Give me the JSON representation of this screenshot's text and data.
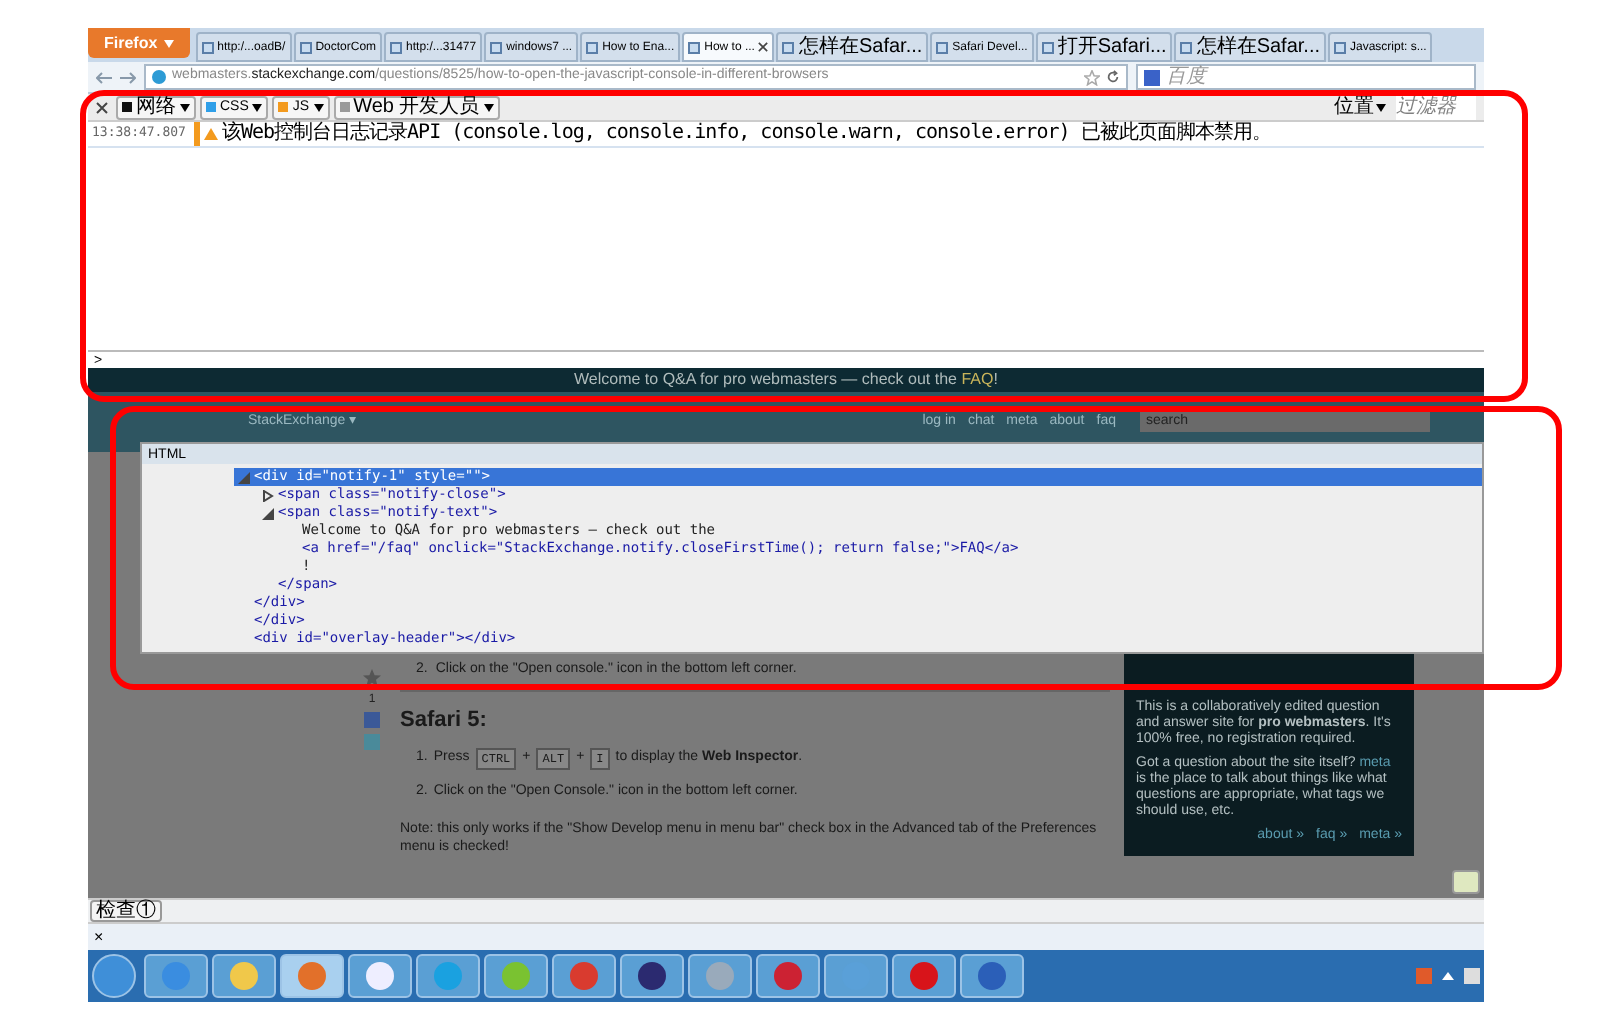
{
  "browser": {
    "menu_button": "Firefox",
    "tabs": [
      {
        "label": "http:/...oadB/",
        "selected": false
      },
      {
        "label": "DoctorCom",
        "selected": false
      },
      {
        "label": "http:/...31477",
        "selected": false
      },
      {
        "label": "windows7 ...",
        "selected": false
      },
      {
        "label": "How to Ena...",
        "selected": false
      },
      {
        "label": "How to ...",
        "selected": true
      },
      {
        "label": "怎样在Safar...",
        "selected": false
      },
      {
        "label": "Safari Devel...",
        "selected": false
      },
      {
        "label": "打开Safari...",
        "selected": false
      },
      {
        "label": "怎样在Safar...",
        "selected": false
      },
      {
        "label": "Javascript: s...",
        "selected": false
      }
    ],
    "url": {
      "subdomain": "webmasters.",
      "domain": "stackexchange.com",
      "path": "/questions/8525/how-to-open-the-javascript-console-in-different-browsers"
    },
    "search_placeholder": "百度"
  },
  "console": {
    "filters": [
      {
        "label": "网络",
        "color": "#111111"
      },
      {
        "label": "CSS",
        "color": "#2f9fe8"
      },
      {
        "label": "JS",
        "color": "#f39a1e"
      },
      {
        "label": "Web 开发人员",
        "color": "#9a9a9a"
      }
    ],
    "position_label": "位置",
    "filter_placeholder": "过滤器",
    "logs": [
      {
        "kind": "warning",
        "time": "13:38:47.807",
        "message": "该Web控制台日志记录API (console.log, console.info, console.warn, console.error) 已被此页面脚本禁用。"
      }
    ],
    "prompt": ">"
  },
  "page": {
    "banner": {
      "text": "Welcome to Q&A for pro webmasters — check out the",
      "link": "FAQ",
      "end": "!"
    },
    "header": {
      "logo": "StackExchange ▾",
      "links": [
        "log in",
        "chat",
        "meta",
        "about",
        "faq"
      ],
      "search_placeholder": "search"
    },
    "inspector": {
      "title": "HTML",
      "nodes": [
        {
          "kind": "element",
          "open": "<div id=\"notify-1\" style=\"\">",
          "close": "</div>",
          "expanded": true,
          "selected": true,
          "children": [
            {
              "kind": "element",
              "open": "<span class=\"notify-close\">",
              "expanded": false,
              "selected": false
            },
            {
              "kind": "element",
              "open": "<span class=\"notify-text\">",
              "close": "</span>",
              "expanded": true,
              "selected": false,
              "children": [
                {
                  "kind": "text",
                  "open": "Welcome to Q&A for pro webmasters — check out the"
                },
                {
                  "kind": "tag",
                  "open": "<a href=\"/faq\" onclick=\"StackExchange.notify.closeFirstTime(); return false;\">FAQ</a>"
                },
                {
                  "kind": "text",
                  "open": "!"
                }
              ]
            }
          ]
        },
        {
          "kind": "tag",
          "open": "</div>"
        },
        {
          "kind": "tag",
          "open": "<div id=\"overlay-header\"></div>"
        }
      ]
    },
    "votes": "1",
    "previous_step": {
      "number": "2.",
      "text": "Click on the \"Open console.\" icon in the bottom left corner."
    },
    "section_title": "Safari 5:",
    "steps": [
      {
        "number": "1.",
        "parts": [
          {
            "kind": "text",
            "text": "Press"
          },
          {
            "kind": "key",
            "text": "CTRL"
          },
          {
            "kind": "text",
            "text": "+"
          },
          {
            "kind": "key",
            "text": "ALT"
          },
          {
            "kind": "text",
            "text": "+"
          },
          {
            "kind": "key",
            "text": "I"
          },
          {
            "kind": "text",
            "text": "to display the **Web Inspector**."
          }
        ]
      },
      {
        "number": "2.",
        "parts": [
          {
            "kind": "text",
            "text": "Click on the \"Open Console.\" icon in the bottom left corner."
          }
        ]
      }
    ],
    "note": "Note: this only works if the \"Show Develop menu in menu bar\" check box in the Advanced tab of the Preferences menu is checked!",
    "sidebar": {
      "intro": "This is a collaboratively edited question and answer site for **pro webmasters**. It's 100% free, no registration required.",
      "question_before": "Got a question about the site itself?",
      "question_link": "meta",
      "question_after": "is the place to talk about things like what questions are appropriate, what tags we should use, etc.",
      "links": [
        "about »",
        "faq »",
        "meta »"
      ]
    }
  },
  "inspect_button": "检查①",
  "close_bar": "×"
}
